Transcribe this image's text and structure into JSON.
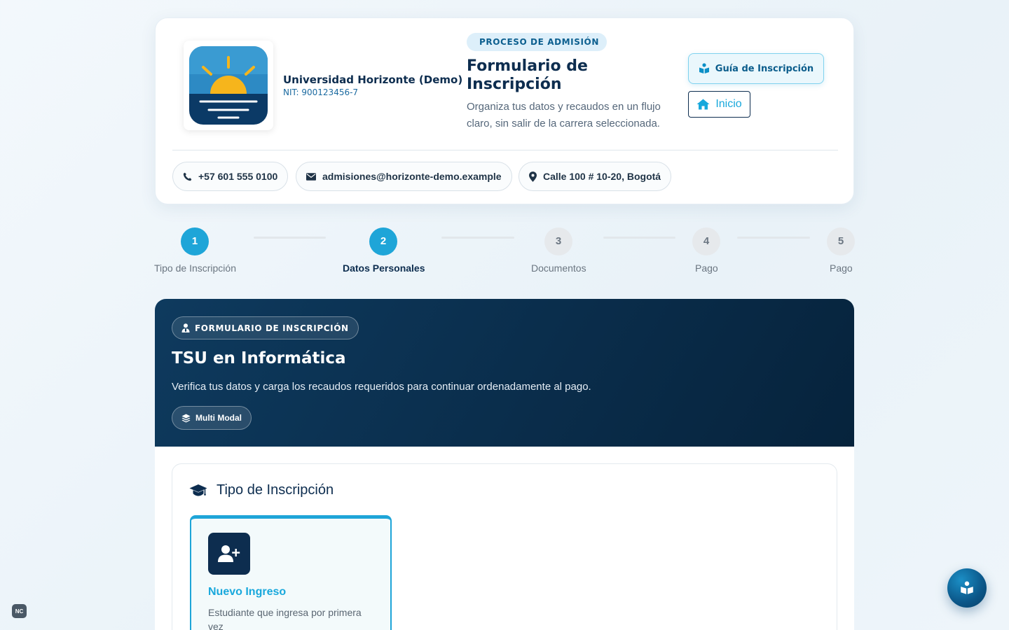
{
  "header": {
    "university_name": "Universidad Horizonte (Demo)",
    "nit": "NIT: 900123456-7",
    "process_badge": "PROCESO DE ADMISIÓN",
    "form_title": "Formulario de Inscripción",
    "form_subtitle": "Organiza tus datos y recaudos en un flujo claro, sin salir de la carrera seleccionada.",
    "guide_button": "Guía de Inscripción",
    "home_button": "Inicio",
    "contacts": {
      "phone": "+57 601 555 0100",
      "email": "admisiones@horizonte-demo.example",
      "address": "Calle 100 # 10-20, Bogotá"
    }
  },
  "stepper": {
    "steps": [
      {
        "number": "1",
        "label": "Tipo de Inscripción",
        "state": "done"
      },
      {
        "number": "2",
        "label": "Datos Personales",
        "state": "current"
      },
      {
        "number": "3",
        "label": "Documentos",
        "state": "pending"
      },
      {
        "number": "4",
        "label": "Pago",
        "state": "pending"
      },
      {
        "number": "5",
        "label": "Pago",
        "state": "pending"
      }
    ]
  },
  "hero": {
    "badge": "FORMULARIO DE INSCRIPCIÓN",
    "title": "TSU en Informática",
    "subtitle": "Verifica tus datos y carga los recaudos requeridos para continuar ordenadamente al pago.",
    "mode": "Multi Modal"
  },
  "section": {
    "title": "Tipo de Inscripción",
    "option": {
      "title": "Nuevo Ingreso",
      "description": "Estudiante que ingresa por primera vez"
    }
  },
  "widgets": {
    "nc_badge": "NC"
  },
  "colors": {
    "accent": "#1ea5d8",
    "navy": "#0d2d4f",
    "logo_sun": "#f6b51c"
  },
  "icons": {
    "phone": "phone-icon",
    "email": "envelope-icon",
    "address": "map-pin-icon",
    "guide": "book-reader-icon",
    "home": "home-icon",
    "section": "graduation-cap-icon",
    "option": "user-plus-icon",
    "mode": "layers-icon",
    "fab": "book-reader-icon"
  }
}
